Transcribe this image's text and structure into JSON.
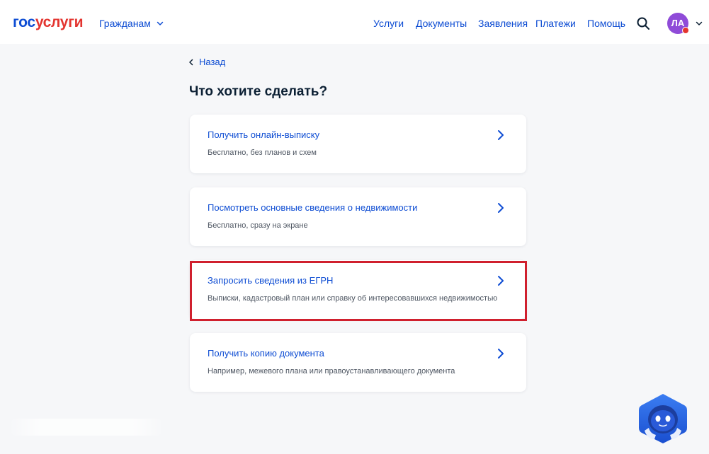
{
  "header": {
    "logo_part1": "гос",
    "logo_part2": "услуги",
    "role_label": "Гражданам",
    "nav": [
      "Услуги",
      "Документы",
      "Заявления",
      "Платежи",
      "Помощь"
    ],
    "avatar_initials": "ЛА"
  },
  "main": {
    "back_label": "Назад",
    "title": "Что хотите сделать?",
    "options": [
      {
        "title": "Получить онлайн-выписку",
        "description": "Бесплатно, без планов и схем"
      },
      {
        "title": "Посмотреть основные сведения о недвижимости",
        "description": "Бесплатно, сразу на экране"
      },
      {
        "title": "Запросить сведения из ЕГРН",
        "description": "Выписки, кадастровый план или справку об интересовавшихся недвижимостью"
      },
      {
        "title": "Получить копию документа",
        "description": "Например, межевого плана или правоустанавливающего документа"
      }
    ]
  },
  "colors": {
    "brand_blue": "#0d4cd3",
    "brand_red": "#e3342f",
    "avatar_purple": "#8f4bd8",
    "highlight_red": "#d0202e"
  },
  "icons": [
    "search-icon",
    "chevron-down-icon",
    "chevron-left-icon",
    "chevron-right-icon",
    "robot-assistant-icon"
  ]
}
